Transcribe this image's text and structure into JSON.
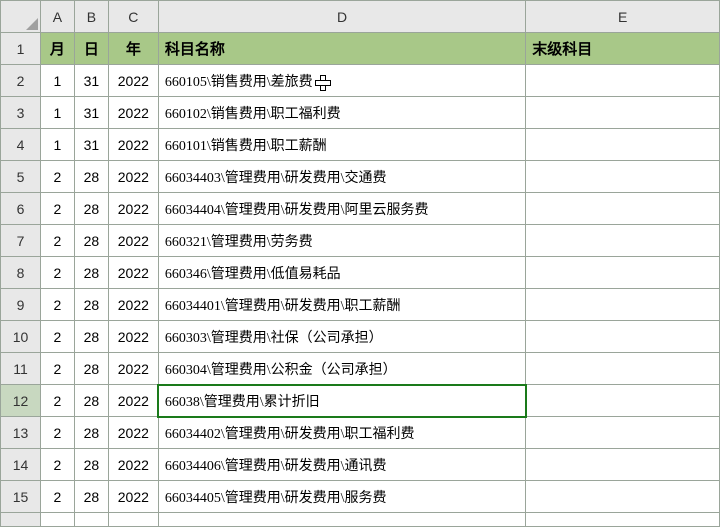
{
  "columns": [
    "A",
    "B",
    "C",
    "D",
    "E"
  ],
  "headers": {
    "A": "月",
    "B": "日",
    "C": "年",
    "D": "科目名称",
    "E": "末级科目"
  },
  "selected_row_index": 12,
  "cursor_row": 2,
  "rows": [
    {
      "n": 1,
      "header": true
    },
    {
      "n": 2,
      "A": "1",
      "B": "31",
      "C": "2022",
      "D": "660105\\销售费用\\差旅费",
      "E": ""
    },
    {
      "n": 3,
      "A": "1",
      "B": "31",
      "C": "2022",
      "D": "660102\\销售费用\\职工福利费",
      "E": ""
    },
    {
      "n": 4,
      "A": "1",
      "B": "31",
      "C": "2022",
      "D": "660101\\销售费用\\职工薪酬",
      "E": ""
    },
    {
      "n": 5,
      "A": "2",
      "B": "28",
      "C": "2022",
      "D": "66034403\\管理费用\\研发费用\\交通费",
      "E": ""
    },
    {
      "n": 6,
      "A": "2",
      "B": "28",
      "C": "2022",
      "D": "66034404\\管理费用\\研发费用\\阿里云服务费",
      "E": ""
    },
    {
      "n": 7,
      "A": "2",
      "B": "28",
      "C": "2022",
      "D": "660321\\管理费用\\劳务费",
      "E": ""
    },
    {
      "n": 8,
      "A": "2",
      "B": "28",
      "C": "2022",
      "D": "660346\\管理费用\\低值易耗品",
      "E": ""
    },
    {
      "n": 9,
      "A": "2",
      "B": "28",
      "C": "2022",
      "D": "66034401\\管理费用\\研发费用\\职工薪酬",
      "E": ""
    },
    {
      "n": 10,
      "A": "2",
      "B": "28",
      "C": "2022",
      "D": "660303\\管理费用\\社保（公司承担）",
      "E": ""
    },
    {
      "n": 11,
      "A": "2",
      "B": "28",
      "C": "2022",
      "D": "660304\\管理费用\\公积金（公司承担）",
      "E": ""
    },
    {
      "n": 12,
      "A": "2",
      "B": "28",
      "C": "2022",
      "D": "66038\\管理费用\\累计折旧",
      "E": ""
    },
    {
      "n": 13,
      "A": "2",
      "B": "28",
      "C": "2022",
      "D": "66034402\\管理费用\\研发费用\\职工福利费",
      "E": ""
    },
    {
      "n": 14,
      "A": "2",
      "B": "28",
      "C": "2022",
      "D": "66034406\\管理费用\\研发费用\\通讯费",
      "E": ""
    },
    {
      "n": 15,
      "A": "2",
      "B": "28",
      "C": "2022",
      "D": "66034405\\管理费用\\研发费用\\服务费",
      "E": ""
    }
  ],
  "partial_row": {
    "A": "",
    "B": "",
    "C": "",
    "D": "",
    "E": ""
  }
}
